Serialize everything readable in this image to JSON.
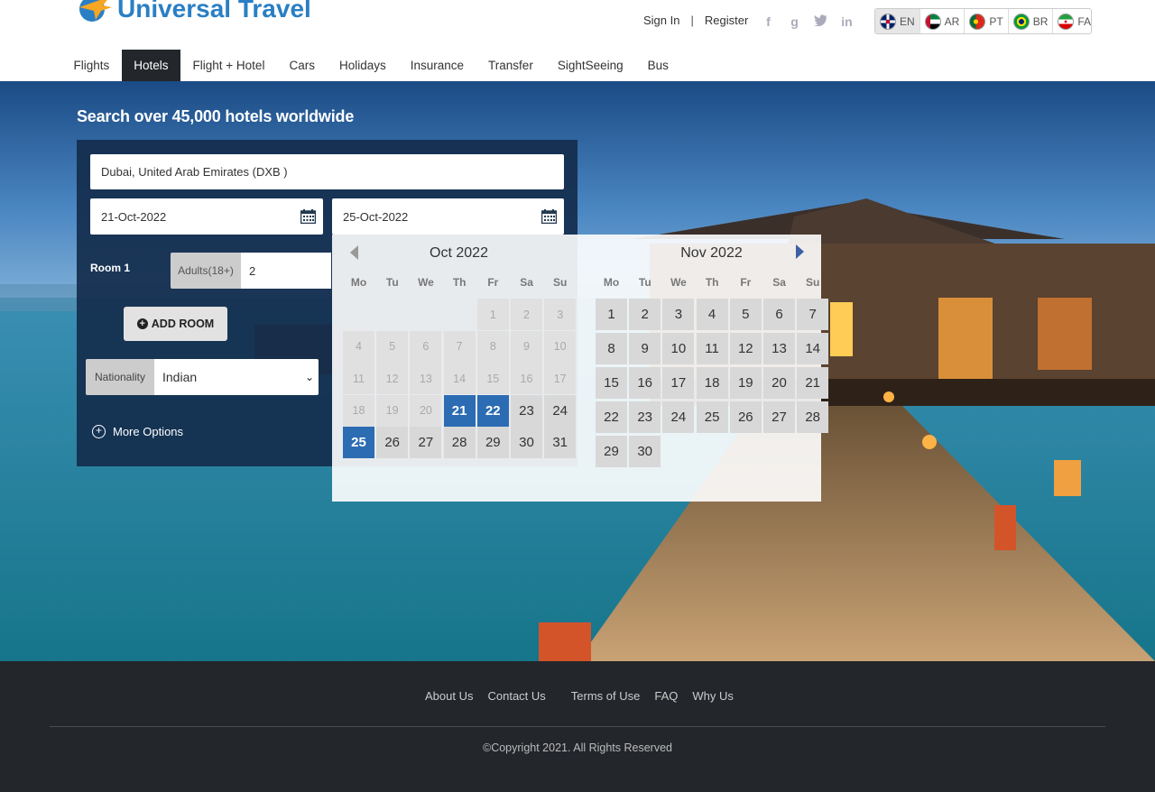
{
  "brand": {
    "name": "Universal Travel"
  },
  "auth": {
    "sign_in": "Sign In",
    "separator": "|",
    "register": "Register"
  },
  "social": [
    "facebook-icon",
    "google-icon",
    "twitter-icon",
    "linkedin-icon"
  ],
  "languages": [
    {
      "code": "EN",
      "active": true
    },
    {
      "code": "AR",
      "active": false
    },
    {
      "code": "PT",
      "active": false
    },
    {
      "code": "BR",
      "active": false
    },
    {
      "code": "FA",
      "active": false
    }
  ],
  "nav": {
    "items": [
      "Flights",
      "Hotels",
      "Flight + Hotel",
      "Cars",
      "Holidays",
      "Insurance",
      "Transfer",
      "SightSeeing",
      "Bus"
    ],
    "active": "Hotels"
  },
  "hero": {
    "title": "Search over 45,000 hotels worldwide"
  },
  "search": {
    "destination": "Dubai, United Arab Emirates (DXB )",
    "checkin": "21-Oct-2022",
    "checkout": "25-Oct-2022",
    "room_label": "Room 1",
    "adults_label": "Adults(18+)",
    "adults_value": "2",
    "add_room": "ADD ROOM",
    "nationality_label": "Nationality",
    "nationality_value": "Indian",
    "more_options": "More Options"
  },
  "datepicker": {
    "days_of_week": [
      "Mo",
      "Tu",
      "We",
      "Th",
      "Fr",
      "Sa",
      "Su"
    ],
    "months": [
      {
        "title": "Oct 2022",
        "first_weekday": 5,
        "days": 31,
        "disabled_through": 20,
        "selected": [
          21,
          22,
          25
        ]
      },
      {
        "title": "Nov 2022",
        "first_weekday": 1,
        "days": 30,
        "disabled_through": 0,
        "selected": []
      }
    ]
  },
  "footer": {
    "links": [
      "About Us",
      "Contact Us",
      "Terms of Use",
      "FAQ",
      "Why Us"
    ],
    "copyright": "©Copyright 2021. All Rights Reserved"
  },
  "colors": {
    "brand": "#2a7fc4",
    "nav_active": "#23272b",
    "selected_day": "#2c6cb3",
    "footer": "#23262b"
  }
}
